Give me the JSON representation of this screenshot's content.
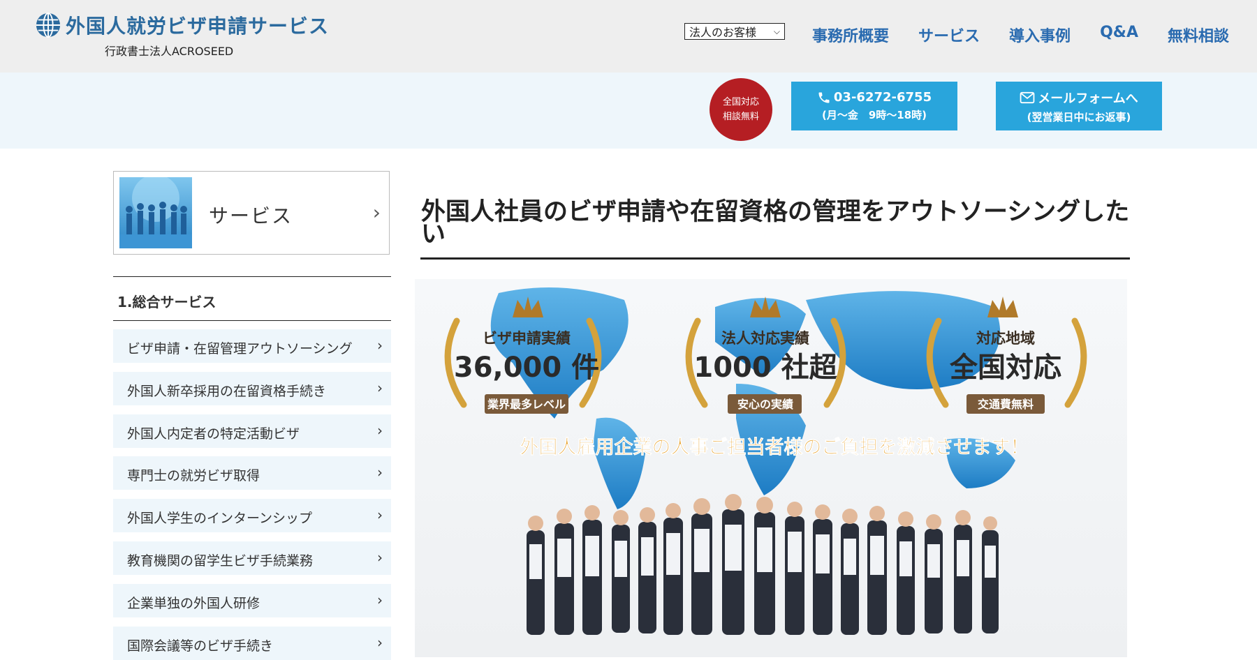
{
  "header": {
    "logo_title": "外国人就労ビザ申請サービス",
    "logo_sub": "行政書士法人ACROSEED",
    "customer_select": {
      "value": "法人のお客様"
    },
    "nav": [
      "事務所概要",
      "サービス",
      "導入事例",
      "Q&A",
      "無料相談"
    ]
  },
  "contact": {
    "badge": {
      "line1": "全国対応",
      "line2": "相談無料"
    },
    "phone": {
      "number": "03-6272-6755",
      "hours": "(月～金　9時～18時)"
    },
    "mail": {
      "label": "メールフォームへ",
      "note": "(翌営業日中にお返事)"
    }
  },
  "sidebar": {
    "service_card": "サービス",
    "section": "1.総合サービス",
    "items": [
      "ビザ申請・在留管理アウトソーシング",
      "外国人新卒採用の在留資格手続き",
      "外国人内定者の特定活動ビザ",
      "専門士の就労ビザ取得",
      "外国人学生のインターンシップ",
      "教育機関の留学生ビザ手続業務",
      "企業単独の外国人研修",
      "国際会議等のビザ手続き"
    ]
  },
  "main": {
    "title": "外国人社員のビザ申請や在留資格の管理をアウトソーシングしたい",
    "hero": {
      "awards": [
        {
          "label": "ビザ申請実績",
          "value": "36,000 件",
          "ribbon": "業界最多レベル"
        },
        {
          "label": "法人対応実績",
          "value": "1000 社超",
          "ribbon": "安心の実績"
        },
        {
          "label": "対応地域",
          "value": "全国対応",
          "ribbon": "交通費無料"
        }
      ],
      "tagline": "外国人雇用企業の人事ご担当者様のご負担を激減させます！"
    }
  },
  "colors": {
    "nav": "#2a6bb0",
    "accent": "#29a5dc",
    "badge": "#b51e23",
    "gold": "#d9a23a"
  }
}
